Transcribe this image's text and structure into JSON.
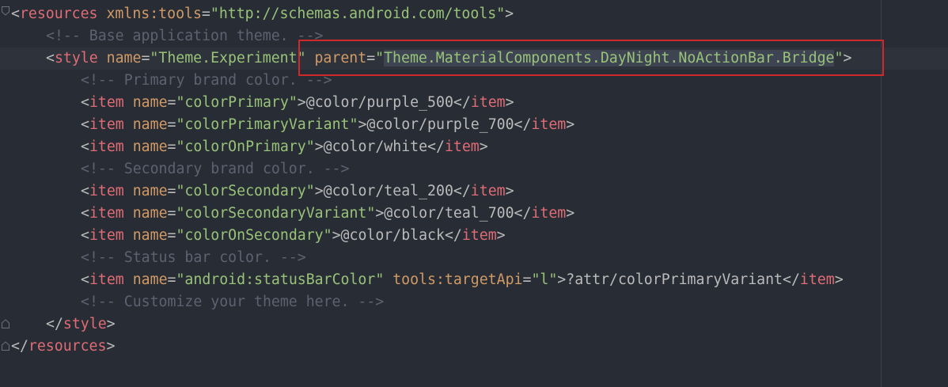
{
  "editor": {
    "lines": [
      {
        "id": "l1",
        "parts": [
          {
            "c": "punct",
            "t": "<"
          },
          {
            "c": "tag",
            "t": "resources"
          },
          {
            "c": "text",
            "t": " "
          },
          {
            "c": "ns",
            "t": "xmlns:tools"
          },
          {
            "c": "punct",
            "t": "="
          },
          {
            "c": "str",
            "t": "\"http://schemas.android.com/tools\""
          },
          {
            "c": "punct",
            "t": ">"
          }
        ]
      },
      {
        "id": "l2",
        "parts": [
          {
            "c": "comment",
            "t": "<!-- Base application theme. -->"
          }
        ]
      },
      {
        "id": "l3",
        "parts": [
          {
            "c": "punct",
            "t": "<"
          },
          {
            "c": "tag",
            "t": "style"
          },
          {
            "c": "text",
            "t": " "
          },
          {
            "c": "attr",
            "t": "name"
          },
          {
            "c": "punct",
            "t": "="
          },
          {
            "c": "str",
            "t": "\"Theme.Experiment\""
          },
          {
            "c": "text",
            "t": " "
          },
          {
            "c": "attr",
            "t": "parent"
          },
          {
            "c": "punct",
            "t": "="
          },
          {
            "c": "str",
            "t": "\""
          },
          {
            "c": "str sel-hl",
            "t": "Theme.MaterialComponents.DayNight.NoActionBar.Bridge"
          },
          {
            "c": "str",
            "t": "\""
          },
          {
            "c": "punct",
            "t": ">"
          }
        ]
      },
      {
        "id": "l4",
        "parts": [
          {
            "c": "comment",
            "t": "<!-- Primary brand color. -->"
          }
        ]
      },
      {
        "id": "l5",
        "parts": [
          {
            "c": "punct",
            "t": "<"
          },
          {
            "c": "tag",
            "t": "item"
          },
          {
            "c": "text",
            "t": " "
          },
          {
            "c": "attr",
            "t": "name"
          },
          {
            "c": "punct",
            "t": "="
          },
          {
            "c": "str",
            "t": "\"colorPrimary\""
          },
          {
            "c": "punct",
            "t": ">"
          },
          {
            "c": "text",
            "t": "@color/purple_500"
          },
          {
            "c": "punct",
            "t": "</"
          },
          {
            "c": "tag",
            "t": "item"
          },
          {
            "c": "punct",
            "t": ">"
          }
        ]
      },
      {
        "id": "l6",
        "parts": [
          {
            "c": "punct",
            "t": "<"
          },
          {
            "c": "tag",
            "t": "item"
          },
          {
            "c": "text",
            "t": " "
          },
          {
            "c": "attr",
            "t": "name"
          },
          {
            "c": "punct",
            "t": "="
          },
          {
            "c": "str",
            "t": "\"colorPrimaryVariant\""
          },
          {
            "c": "punct",
            "t": ">"
          },
          {
            "c": "text",
            "t": "@color/purple_700"
          },
          {
            "c": "punct",
            "t": "</"
          },
          {
            "c": "tag",
            "t": "item"
          },
          {
            "c": "punct",
            "t": ">"
          }
        ]
      },
      {
        "id": "l7",
        "parts": [
          {
            "c": "punct",
            "t": "<"
          },
          {
            "c": "tag",
            "t": "item"
          },
          {
            "c": "text",
            "t": " "
          },
          {
            "c": "attr",
            "t": "name"
          },
          {
            "c": "punct",
            "t": "="
          },
          {
            "c": "str",
            "t": "\"colorOnPrimary\""
          },
          {
            "c": "punct",
            "t": ">"
          },
          {
            "c": "text",
            "t": "@color/white"
          },
          {
            "c": "punct",
            "t": "</"
          },
          {
            "c": "tag",
            "t": "item"
          },
          {
            "c": "punct",
            "t": ">"
          }
        ]
      },
      {
        "id": "l8",
        "parts": [
          {
            "c": "comment",
            "t": "<!-- Secondary brand color. -->"
          }
        ]
      },
      {
        "id": "l9",
        "parts": [
          {
            "c": "punct",
            "t": "<"
          },
          {
            "c": "tag",
            "t": "item"
          },
          {
            "c": "text",
            "t": " "
          },
          {
            "c": "attr",
            "t": "name"
          },
          {
            "c": "punct",
            "t": "="
          },
          {
            "c": "str",
            "t": "\"colorSecondary\""
          },
          {
            "c": "punct",
            "t": ">"
          },
          {
            "c": "text",
            "t": "@color/teal_200"
          },
          {
            "c": "punct",
            "t": "</"
          },
          {
            "c": "tag",
            "t": "item"
          },
          {
            "c": "punct",
            "t": ">"
          }
        ]
      },
      {
        "id": "l10",
        "parts": [
          {
            "c": "punct",
            "t": "<"
          },
          {
            "c": "tag",
            "t": "item"
          },
          {
            "c": "text",
            "t": " "
          },
          {
            "c": "attr",
            "t": "name"
          },
          {
            "c": "punct",
            "t": "="
          },
          {
            "c": "str",
            "t": "\"colorSecondaryVariant\""
          },
          {
            "c": "punct",
            "t": ">"
          },
          {
            "c": "text",
            "t": "@color/teal_700"
          },
          {
            "c": "punct",
            "t": "</"
          },
          {
            "c": "tag",
            "t": "item"
          },
          {
            "c": "punct",
            "t": ">"
          }
        ]
      },
      {
        "id": "l11",
        "parts": [
          {
            "c": "punct",
            "t": "<"
          },
          {
            "c": "tag",
            "t": "item"
          },
          {
            "c": "text",
            "t": " "
          },
          {
            "c": "attr",
            "t": "name"
          },
          {
            "c": "punct",
            "t": "="
          },
          {
            "c": "str",
            "t": "\"colorOnSecondary\""
          },
          {
            "c": "punct",
            "t": ">"
          },
          {
            "c": "text",
            "t": "@color/black"
          },
          {
            "c": "punct",
            "t": "</"
          },
          {
            "c": "tag",
            "t": "item"
          },
          {
            "c": "punct",
            "t": ">"
          }
        ]
      },
      {
        "id": "l12",
        "parts": [
          {
            "c": "comment",
            "t": "<!-- Status bar color. -->"
          }
        ]
      },
      {
        "id": "l13",
        "parts": [
          {
            "c": "punct",
            "t": "<"
          },
          {
            "c": "tag",
            "t": "item"
          },
          {
            "c": "text",
            "t": " "
          },
          {
            "c": "attr",
            "t": "name"
          },
          {
            "c": "punct",
            "t": "="
          },
          {
            "c": "str",
            "t": "\"android:statusBarColor\""
          },
          {
            "c": "text",
            "t": " "
          },
          {
            "c": "ns",
            "t": "tools:targetApi"
          },
          {
            "c": "punct",
            "t": "="
          },
          {
            "c": "str",
            "t": "\"l\""
          },
          {
            "c": "punct",
            "t": ">"
          },
          {
            "c": "text",
            "t": "?attr/colorPrimaryVariant"
          },
          {
            "c": "punct",
            "t": "</"
          },
          {
            "c": "tag",
            "t": "item"
          },
          {
            "c": "punct",
            "t": ">"
          }
        ]
      },
      {
        "id": "l14",
        "parts": [
          {
            "c": "comment",
            "t": "<!-- Customize your theme here. -->"
          }
        ]
      },
      {
        "id": "l15",
        "parts": [
          {
            "c": "punct",
            "t": "</"
          },
          {
            "c": "tag",
            "t": "style"
          },
          {
            "c": "punct",
            "t": ">"
          }
        ]
      },
      {
        "id": "l16",
        "parts": [
          {
            "c": "punct",
            "t": "</"
          },
          {
            "c": "tag",
            "t": "resources"
          },
          {
            "c": "punct",
            "t": ">"
          }
        ]
      }
    ]
  },
  "colors": {
    "background": "#282c34",
    "tag": "#e06c75",
    "attribute": "#d19a66",
    "string": "#98c379",
    "comment": "#5c6370",
    "highlight_box": "#d0282b"
  },
  "icons": {
    "intention": "lightbulb-icon",
    "fold": "fold-marker-icon"
  }
}
